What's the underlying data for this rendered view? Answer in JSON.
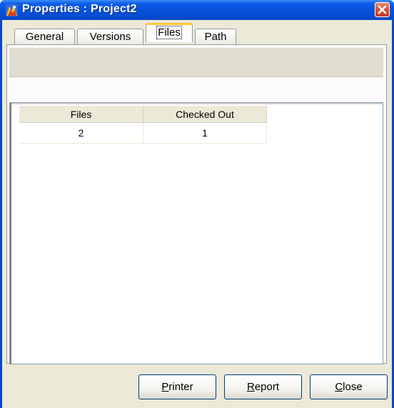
{
  "window": {
    "title": "Properties : Project2",
    "close_icon": "close-icon",
    "app_icon": "project-properties-icon"
  },
  "tabs": [
    {
      "label": "General",
      "active": false
    },
    {
      "label": "Versions",
      "active": false
    },
    {
      "label": "Files",
      "active": true
    },
    {
      "label": "Path",
      "active": false
    }
  ],
  "table": {
    "headers": [
      "Files",
      "Checked Out"
    ],
    "rows": [
      [
        "2",
        "1"
      ]
    ]
  },
  "buttons": {
    "printer": {
      "mnemonic": "P",
      "rest": "rinter"
    },
    "report": {
      "mnemonic": "R",
      "rest": "eport"
    },
    "close": {
      "mnemonic": "C",
      "rest": "lose"
    }
  },
  "colors": {
    "titlebar": "#0653dc",
    "dialog_face": "#ece9d8",
    "active_tab_highlight": "#ffc83c",
    "close_button": "#d9533a"
  }
}
